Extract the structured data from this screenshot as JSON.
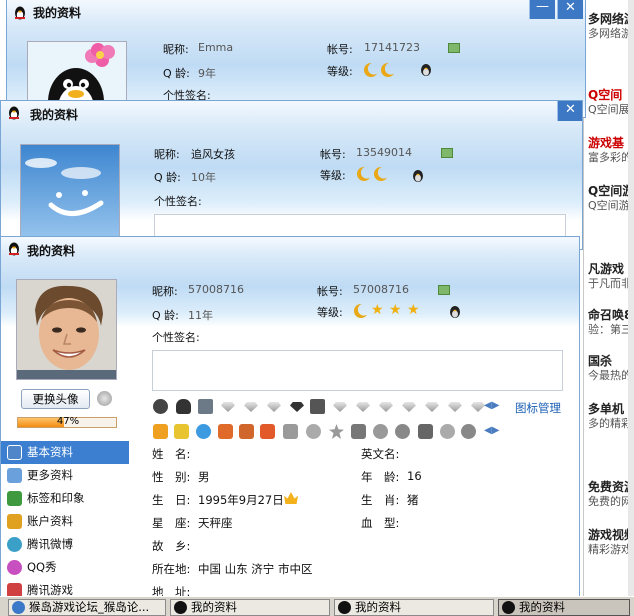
{
  "bg_web": {
    "items": [
      {
        "title": "多网络游",
        "sub": "多网络游",
        "red": false
      },
      {
        "title": "Q空间",
        "sub": "Q空间展示",
        "red": true
      },
      {
        "title": "游戏基",
        "sub": "富多彩的",
        "red": true
      },
      {
        "title": "Q空间游",
        "sub": "Q空间游",
        "red": false
      },
      {
        "title": "凡游戏",
        "sub": "于凡而非",
        "red": false
      },
      {
        "title": "命召唤8",
        "sub": "验：第三",
        "red": false
      },
      {
        "title": "国杀",
        "sub": "今最热的",
        "red": false
      },
      {
        "title": "多单机",
        "sub": "多的精彩",
        "red": false
      },
      {
        "title": "免费资源",
        "sub": "免费的网络",
        "red": false
      },
      {
        "title": "游戏视频",
        "sub": "精彩游戏视",
        "red": false
      }
    ]
  },
  "windows": [
    {
      "title": "我的资料",
      "nickname_label": "昵称:",
      "nickname": "Emma",
      "account_label": "帐号:",
      "account": "17141723",
      "age_label": "Q 龄:",
      "age": "9年",
      "level_label": "等级:",
      "signature_label": "个性签名:"
    },
    {
      "title": "我的资料",
      "nickname_label": "昵称:",
      "nickname": "追风女孩",
      "account_label": "帐号:",
      "account": "13549014",
      "age_label": "Q 龄:",
      "age": "10年",
      "level_label": "等级:",
      "signature_label": "个性签名:"
    },
    {
      "title": "我的资料",
      "nickname_label": "昵称:",
      "nickname": "57008716",
      "account_label": "帐号:",
      "account": "57008716",
      "age_label": "Q 龄:",
      "age": "11年",
      "level_label": "等级:",
      "signature_label": "个性签名:",
      "change_avatar": "更换头像",
      "progress_text": "47%",
      "progress": 0.47,
      "icon_manage": "图标管理"
    }
  ],
  "sidebar": [
    {
      "label": "基本资料",
      "active": true,
      "color": "#4f86c9"
    },
    {
      "label": "更多资料",
      "active": false,
      "color": "#6aa0dc"
    },
    {
      "label": "标签和印象",
      "active": false,
      "color": "#3f9a3f"
    },
    {
      "label": "账户资料",
      "active": false,
      "color": "#e0a020"
    },
    {
      "label": "腾讯微博",
      "active": false,
      "color": "#3aa0c8"
    },
    {
      "label": "QQ秀",
      "active": false,
      "color": "#c84fc0"
    },
    {
      "label": "腾讯游戏",
      "active": false,
      "color": "#d04040"
    }
  ],
  "info": {
    "name_label": "姓　名:",
    "name": "",
    "en_name_label": "英文名:",
    "en_name": "",
    "gender_label": "性　别:",
    "gender": "男",
    "age_label": "年　龄:",
    "age_val": "16",
    "birthday_label": "生　日:",
    "birthday": "1995年9月27日",
    "zodiac_label": "生　肖:",
    "zodiac": "猪",
    "constellation_label": "星　座:",
    "constellation": "天秤座",
    "blood_label": "血　型:",
    "blood": "",
    "hometown_label": "故　乡:",
    "hometown": "",
    "location_label": "所在地:",
    "location": "中国  山东  济宁  市中区",
    "address_label": "地　址:",
    "address": ""
  },
  "taskbar": [
    {
      "label": "猴岛游戏论坛_猴岛论...",
      "active": false
    },
    {
      "label": "我的资料",
      "active": false
    },
    {
      "label": "我的资料",
      "active": false
    },
    {
      "label": "我的资料",
      "active": true
    }
  ],
  "colors": {
    "title_blue": "#3d78c4",
    "active_blue": "#3c7fd0",
    "link_blue": "#1a5fb4",
    "progress_orange": "#f39a1f"
  }
}
